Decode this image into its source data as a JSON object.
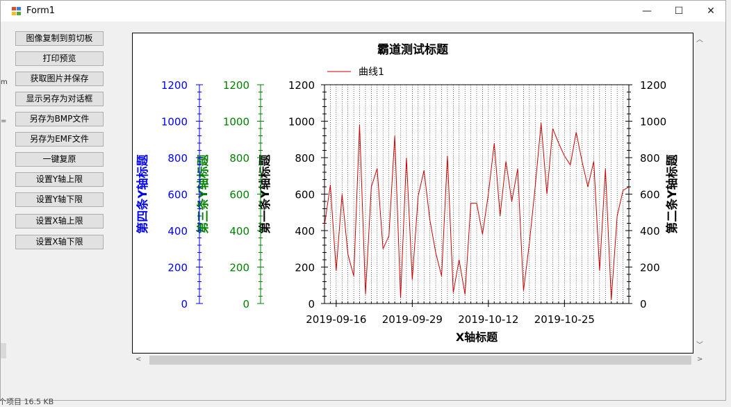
{
  "window": {
    "title": "Form1",
    "controls": {
      "minimize": "—",
      "maximize": "☐",
      "close": "✕"
    }
  },
  "buttons": [
    "图像复制到剪切板",
    "打印预览",
    "获取图片并保存",
    "显示另存为对话框",
    "另存为BMP文件",
    "另存为EMF文件",
    "一键复原",
    "设置Y轴上限",
    "设置Y轴下限",
    "设置X轴上限",
    "设置X轴下限"
  ],
  "status_fragment": "个项目 16.5 KB",
  "colors": {
    "series": "#cc0000",
    "axis4": "#0000ff",
    "axis3": "#008000",
    "axis": "#000000"
  },
  "chart_data": {
    "type": "line",
    "title": "霸道测试标题",
    "xlabel": "X轴标题",
    "y_axes": [
      {
        "title": "第一条Y轴标题",
        "side": "left",
        "color": "#000000",
        "ticks": [
          "0",
          "200",
          "400",
          "600",
          "800",
          "1000",
          "1200"
        ]
      },
      {
        "title": "第二条Y轴标题",
        "side": "right",
        "color": "#000000",
        "ticks": [
          "0",
          "200",
          "400",
          "600",
          "800",
          "1000",
          "1200"
        ]
      },
      {
        "title": "第三条Y轴标题",
        "side": "left",
        "color": "#008000",
        "ticks": [
          "0",
          "200",
          "400",
          "600",
          "800",
          "1000",
          "1200"
        ]
      },
      {
        "title": "第四条Y轴标题",
        "side": "left",
        "color": "#0000ff",
        "ticks": [
          "0",
          "200",
          "400",
          "600",
          "800",
          "1000",
          "1200"
        ]
      }
    ],
    "ylim": [
      0,
      1200
    ],
    "xlim": [
      "2019-09-14",
      "2019-11-05"
    ],
    "x_tick_labels": [
      "2019-09-16",
      "2019-09-29",
      "2019-10-12",
      "2019-10-25"
    ],
    "legend": {
      "position": "top-left",
      "entries": [
        "曲线1"
      ]
    },
    "grid": "vertical dotted lines at daily intervals",
    "series": [
      {
        "name": "曲线1",
        "color": "#cc0000",
        "x": [
          "2019-09-14",
          "2019-09-15",
          "2019-09-16",
          "2019-09-17",
          "2019-09-18",
          "2019-09-19",
          "2019-09-20",
          "2019-09-21",
          "2019-09-22",
          "2019-09-23",
          "2019-09-24",
          "2019-09-25",
          "2019-09-26",
          "2019-09-27",
          "2019-09-28",
          "2019-09-29",
          "2019-09-30",
          "2019-10-01",
          "2019-10-02",
          "2019-10-03",
          "2019-10-04",
          "2019-10-05",
          "2019-10-06",
          "2019-10-07",
          "2019-10-08",
          "2019-10-09",
          "2019-10-10",
          "2019-10-11",
          "2019-10-12",
          "2019-10-13",
          "2019-10-14",
          "2019-10-15",
          "2019-10-16",
          "2019-10-17",
          "2019-10-18",
          "2019-10-19",
          "2019-10-20",
          "2019-10-21",
          "2019-10-22",
          "2019-10-23",
          "2019-10-24",
          "2019-10-25",
          "2019-10-26",
          "2019-10-27",
          "2019-10-28",
          "2019-10-29",
          "2019-10-30",
          "2019-10-31",
          "2019-11-01",
          "2019-11-02",
          "2019-11-03",
          "2019-11-04",
          "2019-11-05"
        ],
        "y": [
          430,
          650,
          180,
          600,
          270,
          150,
          980,
          50,
          640,
          740,
          300,
          370,
          920,
          30,
          800,
          130,
          590,
          730,
          460,
          280,
          150,
          810,
          60,
          240,
          50,
          550,
          550,
          380,
          600,
          880,
          480,
          780,
          560,
          740,
          70,
          330,
          640,
          990,
          600,
          960,
          880,
          810,
          760,
          940,
          780,
          640,
          780,
          180,
          740,
          20,
          480,
          620,
          640
        ]
      }
    ]
  }
}
